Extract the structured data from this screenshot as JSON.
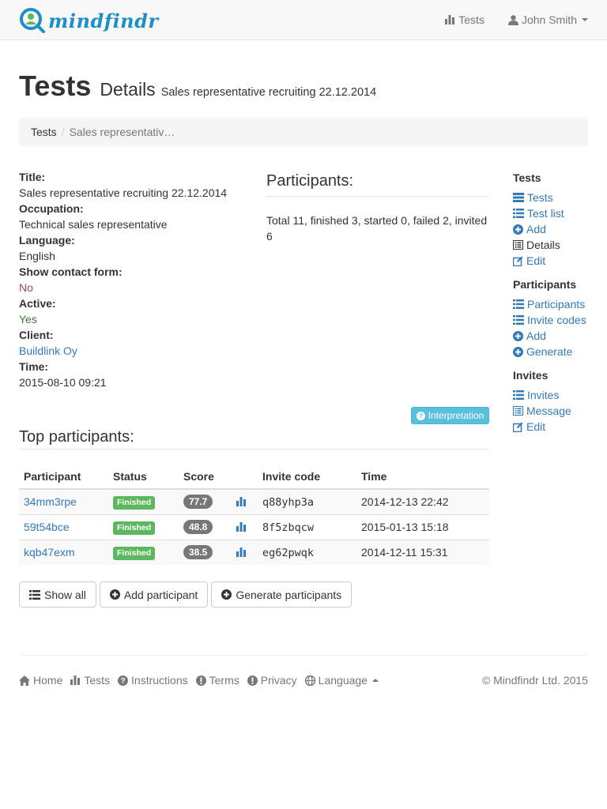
{
  "colors": {
    "link": "#337ab7",
    "brand": "#1c8fc7",
    "success": "#5cb85c",
    "info": "#5bc0de",
    "danger": "#a94442",
    "ok": "#3c763d"
  },
  "navbar": {
    "logo_text": "mindfindr",
    "tests_label": "Tests",
    "user_label": "John Smith"
  },
  "header": {
    "title": "Tests",
    "subtitle": "Details",
    "test_name": "Sales representative recruiting 22.12.2014"
  },
  "breadcrumb": {
    "root": "Tests",
    "current": "Sales representativ…"
  },
  "details": {
    "title_label": "Title:",
    "title_value": "Sales representative recruiting 22.12.2014",
    "occupation_label": "Occupation:",
    "occupation_value": "Technical sales representative",
    "language_label": "Language:",
    "language_value": "English",
    "contact_form_label": "Show contact form:",
    "contact_form_value": "No",
    "active_label": "Active:",
    "active_value": "Yes",
    "client_label": "Client:",
    "client_value": "Buildlink Oy",
    "time_label": "Time:",
    "time_value": "2015-08-10 09:21"
  },
  "summary": {
    "heading": "Participants:",
    "text": "Total 11, finished 3, started 0, failed 2, invited 6"
  },
  "sidebar": {
    "tests_title": "Tests",
    "tests_items": [
      "Tests",
      "Test list",
      "Add",
      "Details",
      "Edit"
    ],
    "participants_title": "Participants",
    "participants_items": [
      "Participants",
      "Invite codes",
      "Add",
      "Generate"
    ],
    "invites_title": "Invites",
    "invites_items": [
      "Invites",
      "Message",
      "Edit"
    ]
  },
  "interpretation_label": "Interpretation",
  "top_participants": {
    "heading": "Top participants:",
    "columns": [
      "Participant",
      "Status",
      "Score",
      "Invite code",
      "Time"
    ],
    "rows": [
      {
        "participant": "34mm3rpe",
        "status": "Finished",
        "score": "77.7",
        "invite_code": "q88yhp3a",
        "time": "2014-12-13 22:42"
      },
      {
        "participant": "59t54bce",
        "status": "Finished",
        "score": "48.8",
        "invite_code": "8f5zbqcw",
        "time": "2015-01-13 15:18"
      },
      {
        "participant": "kqb47exm",
        "status": "Finished",
        "score": "38.5",
        "invite_code": "eg62pwqk",
        "time": "2014-12-11 15:31"
      }
    ]
  },
  "actions": {
    "show_all": "Show all",
    "add_participant": "Add participant",
    "generate_participants": "Generate participants"
  },
  "footer": {
    "home": "Home",
    "tests": "Tests",
    "instructions": "Instructions",
    "terms": "Terms",
    "privacy": "Privacy",
    "language": "Language",
    "copyright": "© Mindfindr Ltd. 2015"
  }
}
